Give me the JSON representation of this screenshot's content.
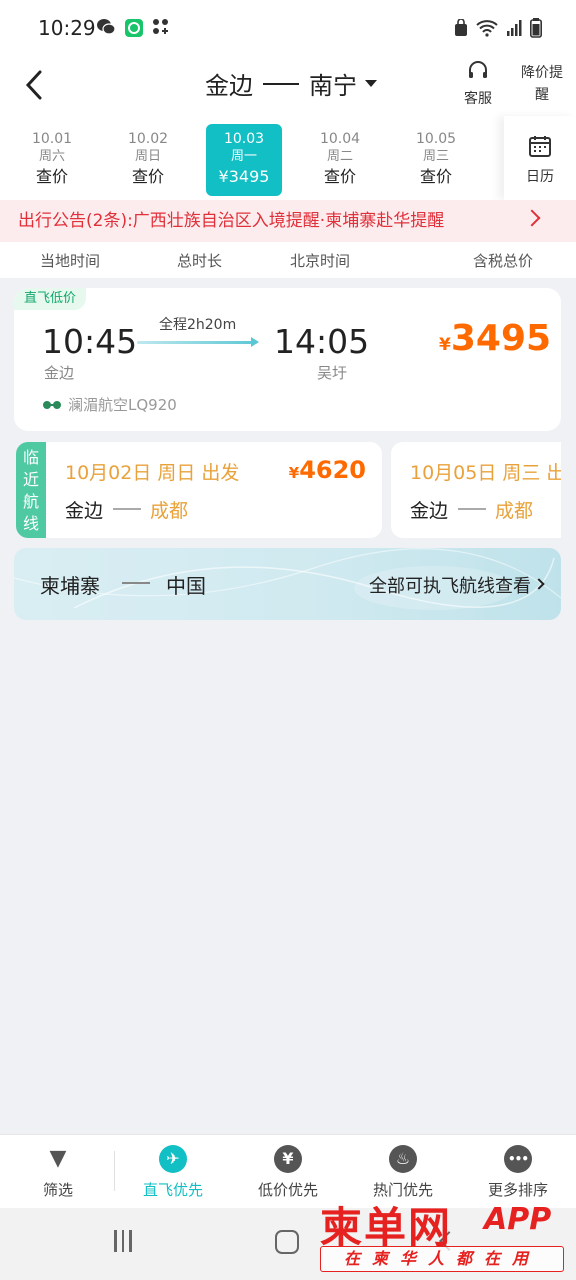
{
  "status_bar": {
    "time": "10:29"
  },
  "header": {
    "from_city": "金边",
    "to_city": "南宁",
    "service_label": "客服",
    "price_alert_label": "降价提醒"
  },
  "date_tabs": [
    {
      "date": "10.01",
      "weekday": "周六",
      "price": "查价",
      "active": false
    },
    {
      "date": "10.02",
      "weekday": "周日",
      "price": "查价",
      "active": false
    },
    {
      "date": "10.03",
      "weekday": "周一",
      "price": "¥3495",
      "active": true
    },
    {
      "date": "10.04",
      "weekday": "周二",
      "price": "查价",
      "active": false
    },
    {
      "date": "10.05",
      "weekday": "周三",
      "price": "查价",
      "active": false
    }
  ],
  "calendar_label": "日历",
  "notice": {
    "text": "出行公告(2条):广西壮族自治区入境提醒·柬埔寨赴华提醒"
  },
  "columns": {
    "local_time": "当地时间",
    "duration": "总时长",
    "beijing_time": "北京时间",
    "total_price": "含税总价"
  },
  "flight": {
    "tag": "直飞低价",
    "dep_time": "10:45",
    "arr_time": "14:05",
    "dep_city": "金边",
    "arr_city": "吴圩",
    "duration": "全程2h20m",
    "currency": "¥",
    "price": "3495",
    "airline": "澜湄航空LQ920"
  },
  "nearby": {
    "label": "临近航线",
    "items": [
      {
        "date": "10月02日 周日 出发",
        "currency": "¥",
        "price": "4620",
        "from": "金边",
        "to": "成都"
      },
      {
        "date": "10月05日 周三 出",
        "from": "金边",
        "to": "成都"
      }
    ]
  },
  "banner": {
    "from": "柬埔寨",
    "to": "中国",
    "link": "全部可执飞航线查看"
  },
  "bottom_nav": [
    {
      "label": "筛选",
      "icon": "filter-icon",
      "glyph": "▼",
      "active": false
    },
    {
      "label": "直飞优先",
      "icon": "plane-icon",
      "glyph": "✈",
      "active": true
    },
    {
      "label": "低价优先",
      "icon": "yen-icon",
      "glyph": "¥",
      "active": false
    },
    {
      "label": "热门优先",
      "icon": "flame-icon",
      "glyph": "♨",
      "active": false
    },
    {
      "label": "更多排序",
      "icon": "more-icon",
      "glyph": "•••",
      "active": false
    }
  ],
  "watermark": {
    "brand": "柬单网",
    "app": "APP",
    "slogan": "在柬华人都在用"
  },
  "colors": {
    "accent": "#12bfc4",
    "price": "#ff6a00",
    "notice": "#e0303a",
    "nearby_tag": "#4fc9a2"
  }
}
